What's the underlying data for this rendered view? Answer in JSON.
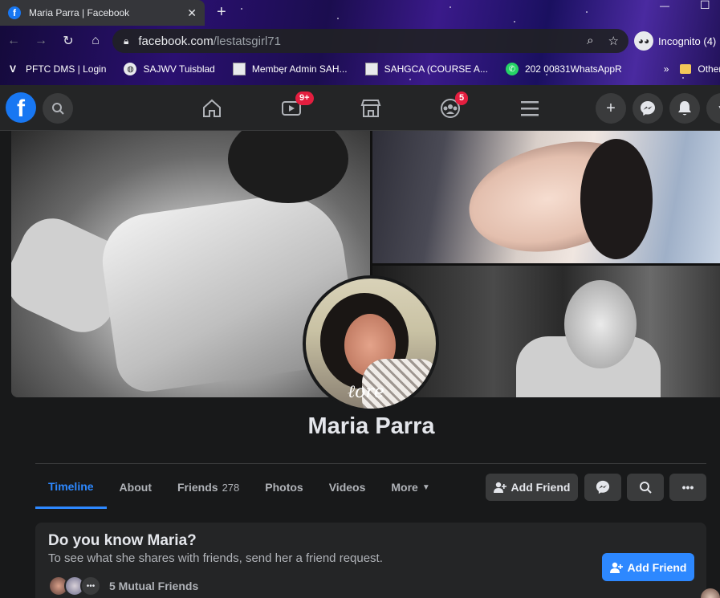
{
  "browser": {
    "tab_title": "Maria Parra | Facebook",
    "url_domain": "facebook.com",
    "url_path": "/lestatsgirl71",
    "incognito_label": "Incognito (4)",
    "bookmarks": [
      {
        "label": "PFTC DMS | Login",
        "icon": "v-logo-icon"
      },
      {
        "label": "SAJWV Tuisblad",
        "icon": "globe-icon"
      },
      {
        "label": "Member Admin SAH...",
        "icon": "page-icon"
      },
      {
        "label": "SAHGCA (COURSE A...",
        "icon": "page-icon"
      },
      {
        "label": "202 00831WhatsAppR",
        "icon": "whatsapp-icon"
      }
    ],
    "more_bookmarks": "»",
    "other_bookmarks": "Other boo"
  },
  "fbnav": {
    "watch_badge": "9+",
    "groups_badge": "5"
  },
  "profile": {
    "name": "Maria Parra",
    "avatar_signature": "ℓore",
    "tabs": [
      {
        "label": "Timeline"
      },
      {
        "label": "About"
      },
      {
        "label": "Friends",
        "count": "278"
      },
      {
        "label": "Photos"
      },
      {
        "label": "Videos"
      },
      {
        "label": "More"
      }
    ],
    "add_friend_label": "Add Friend"
  },
  "know_card": {
    "title": "Do you know Maria?",
    "subtitle": "To see what she shares with friends, send her a friend request.",
    "add_friend_label": "Add Friend",
    "mutual_friends": "5 Mutual Friends"
  },
  "colors": {
    "accent": "#2d88ff",
    "fb_blue": "#1877f2",
    "badge": "#e41e3f"
  }
}
